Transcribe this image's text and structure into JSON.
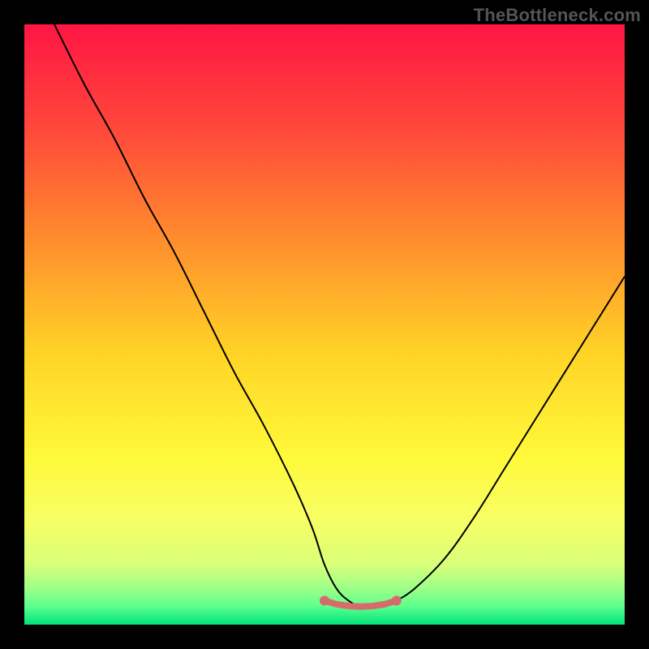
{
  "watermark": "TheBottleneck.com",
  "colors": {
    "black": "#000000",
    "line": "#000000",
    "marker": "#d96a6a",
    "gradient_stops": [
      {
        "offset": 0.0,
        "color": "#ff1544"
      },
      {
        "offset": 0.18,
        "color": "#ff4a3a"
      },
      {
        "offset": 0.35,
        "color": "#ff8a2e"
      },
      {
        "offset": 0.55,
        "color": "#ffd426"
      },
      {
        "offset": 0.72,
        "color": "#fff93a"
      },
      {
        "offset": 0.83,
        "color": "#f6ff66"
      },
      {
        "offset": 0.9,
        "color": "#d8ff7a"
      },
      {
        "offset": 0.94,
        "color": "#9cff88"
      },
      {
        "offset": 0.97,
        "color": "#5cff8e"
      },
      {
        "offset": 1.0,
        "color": "#00e47a"
      }
    ]
  },
  "chart_data": {
    "type": "line",
    "title": "",
    "xlabel": "",
    "ylabel": "",
    "xlim": [
      0,
      100
    ],
    "ylim": [
      0,
      100
    ],
    "series": [
      {
        "name": "curve",
        "x": [
          5,
          10,
          15,
          20,
          25,
          30,
          35,
          40,
          45,
          48,
          50,
          52,
          54,
          56,
          58,
          60,
          62,
          65,
          70,
          75,
          80,
          85,
          90,
          95,
          100
        ],
        "values": [
          100,
          90,
          81,
          71,
          62,
          52,
          42,
          33,
          23,
          16,
          10,
          6,
          4,
          3,
          3,
          3,
          4,
          6,
          11,
          18,
          26,
          34,
          42,
          50,
          58
        ]
      },
      {
        "name": "flat-zone-markers",
        "x": [
          50,
          52,
          54,
          56,
          58,
          60,
          62
        ],
        "values": [
          4.0,
          3.4,
          3.1,
          3.0,
          3.1,
          3.4,
          4.0
        ]
      }
    ]
  }
}
